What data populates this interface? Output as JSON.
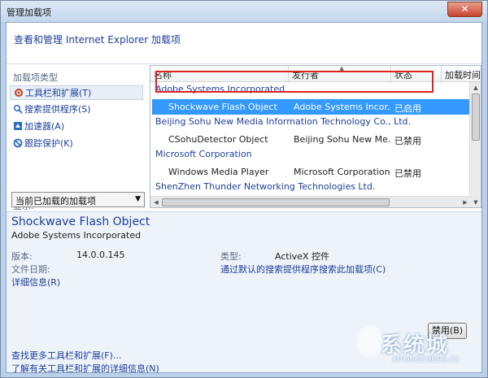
{
  "window": {
    "title": "管理加载项",
    "close_glyph": "✕"
  },
  "header": {
    "text": "查看和管理 Internet Explorer 加载项"
  },
  "left": {
    "heading": "加载项类型",
    "items": [
      {
        "label": "工具栏和扩展(T)",
        "icon": "gear-icon"
      },
      {
        "label": "搜索提供程序(S)",
        "icon": "search-icon"
      },
      {
        "label": "加速器(A)",
        "icon": "accelerator-icon"
      },
      {
        "label": "跟踪保护(K)",
        "icon": "block-icon"
      }
    ],
    "show_label": "显示:",
    "show_select": "当前已加载的加载项"
  },
  "list": {
    "columns": [
      "名称",
      "发行者",
      "状态",
      "加载时间"
    ],
    "rows": [
      {
        "type": "group",
        "name": "Adobe Systems Incorporated"
      },
      {
        "type": "item",
        "name": "Shockwave Flash Object",
        "publisher": "Adobe Systems Incor...",
        "status": "已启用",
        "selected": true
      },
      {
        "type": "group",
        "name": "Beijing Sohu New Media Information Technology Co., Ltd."
      },
      {
        "type": "item",
        "name": "CSohuDetector Object",
        "publisher": "Beijing Sohu New Me...",
        "status": "已禁用",
        "selected": false
      },
      {
        "type": "group",
        "name": "Microsoft Corporation"
      },
      {
        "type": "item",
        "name": "Windows Media Player",
        "publisher": "Microsoft Corporation",
        "status": "已禁用",
        "selected": false
      },
      {
        "type": "group",
        "name": "ShenZhen Thunder Networking Technologies Ltd."
      }
    ]
  },
  "details": {
    "title": "Shockwave Flash Object",
    "publisher": "Adobe Systems Incorporated",
    "version_label": "版本:",
    "version_value": "14.0.0.145",
    "filedate_label": "文件日期:",
    "more_info_link": "详细信息(R)",
    "type_label": "类型:",
    "type_value": "ActiveX 控件",
    "search_link": "通过默认的搜索提供程序搜索此加载项(C)",
    "disable_button": "禁用(B)",
    "find_more_link": "查找更多工具栏和扩展(F)...",
    "learn_more_link": "了解有关工具栏和扩展的详细信息(N)"
  },
  "watermark": {
    "text": "系统城",
    "url": "XITONGCHENG.CC"
  },
  "colors": {
    "selection": "#3399ff",
    "link": "#1d3f9a",
    "highlight_box": "#e02222"
  }
}
